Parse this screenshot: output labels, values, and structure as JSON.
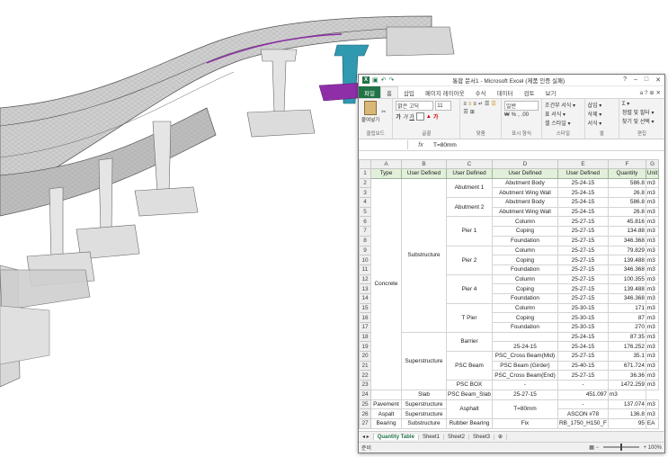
{
  "window": {
    "title": "통합 문서1 - Microsoft Excel (제품 인증 실패)",
    "controls": [
      "?",
      "–",
      "□",
      "✕"
    ]
  },
  "ribbon_tabs": [
    "파일",
    "홈",
    "삽입",
    "페이지 레이아웃",
    "수식",
    "데이터",
    "검토",
    "보기"
  ],
  "ribbon_right": "a ? ⊕ ✕",
  "ribbon": {
    "clipboard": {
      "paste": "붙여넣기",
      "label": "클립보드"
    },
    "font": {
      "name": "맑은 고딕",
      "size": "11",
      "label": "글꼴"
    },
    "align": {
      "label": "맞춤"
    },
    "number": {
      "format": "일반",
      "label": "표시 형식"
    },
    "styles": {
      "items": [
        "조건부 서식 ▾",
        "표 서식 ▾",
        "셀 스타일 ▾"
      ],
      "label": "스타일"
    },
    "cells": {
      "items": [
        "삽입 ▾",
        "삭제 ▾",
        "서식 ▾"
      ],
      "label": "셀"
    },
    "edit": {
      "items": [
        "Σ ▾",
        "정렬 및 필터 ▾",
        "찾기 및 선택 ▾"
      ],
      "label": "편집"
    }
  },
  "formula_bar": {
    "name_box": "",
    "fx": "fx",
    "value": "T=80mm"
  },
  "columns": [
    "",
    "A",
    "B",
    "C",
    "D",
    "E",
    "F",
    "G"
  ],
  "header_row": [
    "Type",
    "User Defined",
    "User Defined",
    "User Defined",
    "User Defined",
    "Quantity",
    "Unit"
  ],
  "rows": [
    {
      "n": "2",
      "d": "Abutment Body",
      "e": "25-24-15",
      "f": "586.8",
      "g": "m3"
    },
    {
      "n": "3",
      "d": "Abutment Wing Wall",
      "e": "25-24-15",
      "f": "26.8",
      "g": "m3"
    },
    {
      "n": "4",
      "d": "Abutment Body",
      "e": "25-24-15",
      "f": "586.8",
      "g": "m3"
    },
    {
      "n": "5",
      "d": "Abutment Wing Wall",
      "e": "25-24-15",
      "f": "26.8",
      "g": "m3"
    },
    {
      "n": "6",
      "d": "Column",
      "e": "25-27-15",
      "f": "45.816",
      "g": "m3"
    },
    {
      "n": "7",
      "d": "Coping",
      "e": "25-27-15",
      "f": "134.88",
      "g": "m3"
    },
    {
      "n": "8",
      "d": "Foundation",
      "e": "25-27-15",
      "f": "346.368",
      "g": "m3"
    },
    {
      "n": "9",
      "d": "Column",
      "e": "25-27-15",
      "f": "79.829",
      "g": "m3"
    },
    {
      "n": "10",
      "d": "Coping",
      "e": "25-27-15",
      "f": "139.488",
      "g": "m3"
    },
    {
      "n": "11",
      "d": "Foundation",
      "e": "25-27-15",
      "f": "346.368",
      "g": "m3"
    },
    {
      "n": "12",
      "d": "Column",
      "e": "25-27-15",
      "f": "100.355",
      "g": "m3"
    },
    {
      "n": "13",
      "d": "Coping",
      "e": "25-27-15",
      "f": "139.488",
      "g": "m3"
    },
    {
      "n": "14",
      "d": "Foundation",
      "e": "25-27-15",
      "f": "346.368",
      "g": "m3"
    },
    {
      "n": "15",
      "d": "Column",
      "e": "25-30-15",
      "f": "171",
      "g": "m3"
    },
    {
      "n": "16",
      "d": "Coping",
      "e": "25-30-15",
      "f": "87",
      "g": "m3"
    },
    {
      "n": "17",
      "d": "Foundation",
      "e": "25-30-15",
      "f": "270",
      "g": "m3"
    },
    {
      "n": "18",
      "d": "",
      "e": "25-24-15",
      "f": "87.35",
      "g": "m3"
    },
    {
      "n": "19",
      "d": "25-24-15",
      "e": "25-24-15",
      "f": "176.252",
      "g": "m3"
    },
    {
      "n": "20",
      "d": "PSC_Cross Beam(Mid)",
      "e": "25-27-15",
      "f": "35.1",
      "g": "m3"
    },
    {
      "n": "21",
      "d": "PSC Beam (Girder)",
      "e": "25-40-15",
      "f": "671.724",
      "g": "m3"
    },
    {
      "n": "22",
      "d": "PSC_Cross Beam(End)",
      "e": "25-27-15",
      "f": "36.36",
      "g": "m3"
    },
    {
      "n": "23",
      "d": "-",
      "e": "-",
      "f": "1472.259",
      "g": "m3"
    },
    {
      "n": "24",
      "d": "PSC Beam_Slab",
      "e": "25-27-15",
      "f": "451.097",
      "g": "m3"
    },
    {
      "n": "25",
      "d": "",
      "e": "-",
      "f": "137.074",
      "g": "m3"
    },
    {
      "n": "26",
      "d": "",
      "e": "ASCON #78",
      "f": "136.8",
      "g": "m3"
    },
    {
      "n": "27",
      "d": "Fix",
      "e": "RB_1750_H150_F",
      "f": "95",
      "g": "EA"
    }
  ],
  "merged": {
    "type_concrete": "Concrete",
    "substructure": "Substructure",
    "superstructure": "Superstructure",
    "abutment1": "Abutment 1",
    "abutment2": "Abutment 2",
    "pier1": "Pier 1",
    "pier2": "Pier 2",
    "pier4": "Pier 4",
    "tpier": "T Pier",
    "barrier": "Barrier",
    "pscbeam": "PSC Beam",
    "pscbox": "PSC BOX",
    "slab": "Slab",
    "asphalt": "Asphalt",
    "asphalt_d": "T=80mm",
    "pavement": "Pavement",
    "pavement_b": "Superstructure",
    "aspalt": "Aspalt",
    "aspalt_b": "Superstructure",
    "bearing": "Bearing",
    "bearing_b": "Substructure",
    "rubber": "Rubber Bearing"
  },
  "sheet_tabs": [
    "Quantity Table",
    "Sheet1",
    "Sheet2",
    "Sheet3"
  ],
  "status": {
    "left": "준비",
    "zoom": "100%"
  },
  "colors": {
    "excel_green": "#217346",
    "header_fill": "#e2efda",
    "girder_magenta": "#8f2fa8",
    "pier_teal": "#2b9ab3"
  }
}
